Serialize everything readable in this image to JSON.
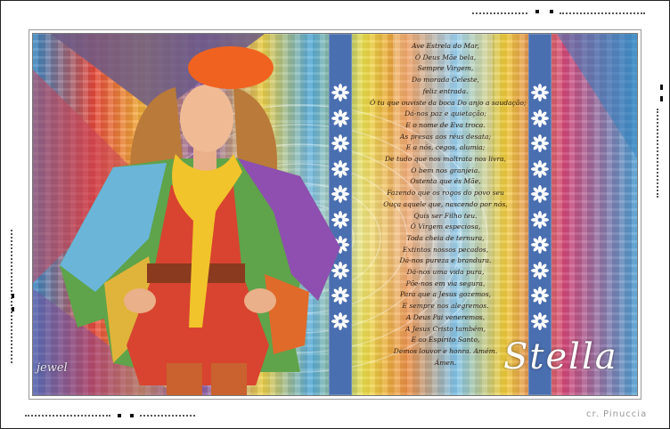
{
  "artwork": {
    "name_text": "Stella",
    "watermark_text": "jewel",
    "credit_text": "cr. Pinuccia",
    "poem_lines": [
      "Ave Estrela do Mar,",
      "Ó Deus Mãe bela,",
      "Sempre Virgem,",
      "Do morada Celeste,",
      "feliz entrada.",
      "Ó tu que ouviste da boca Do anjo a saudação;",
      "Dá-nos paz e quietação;",
      "E o nome de Eva troca.",
      "As presas aos réus desata;",
      "E a nós, cegos, alumia;",
      "De tudo que nos maltrata nos livra,",
      "O bem nos granjeia.",
      "Ostenta que és Mãe,",
      "Fazendo que os rogos do povo seu",
      "Ouça aquele que, nascendo por nós,",
      "Quis ser Filho teu.",
      "Ó Virgem especiosa,",
      "Toda cheia de ternura,",
      "Extintos nossos pecados,",
      "Dá-nos pureza e brandura.",
      "Dá-nos uma vida pura,",
      "Põe-nos em via segura,",
      "Para que a Jesus gozemos,",
      "E sempre nos alegremos.",
      "A Deus Pai veneremos,",
      "A Jesus Cristo também,",
      "E ao Espírito Santo,",
      "Demos louvor e honra. Amém.",
      "Ámen."
    ],
    "colors": {
      "stripe": "#4a6fb0",
      "beret": "#f0621f",
      "scarf": "#f2c42b",
      "dress": "#d8442f"
    }
  }
}
